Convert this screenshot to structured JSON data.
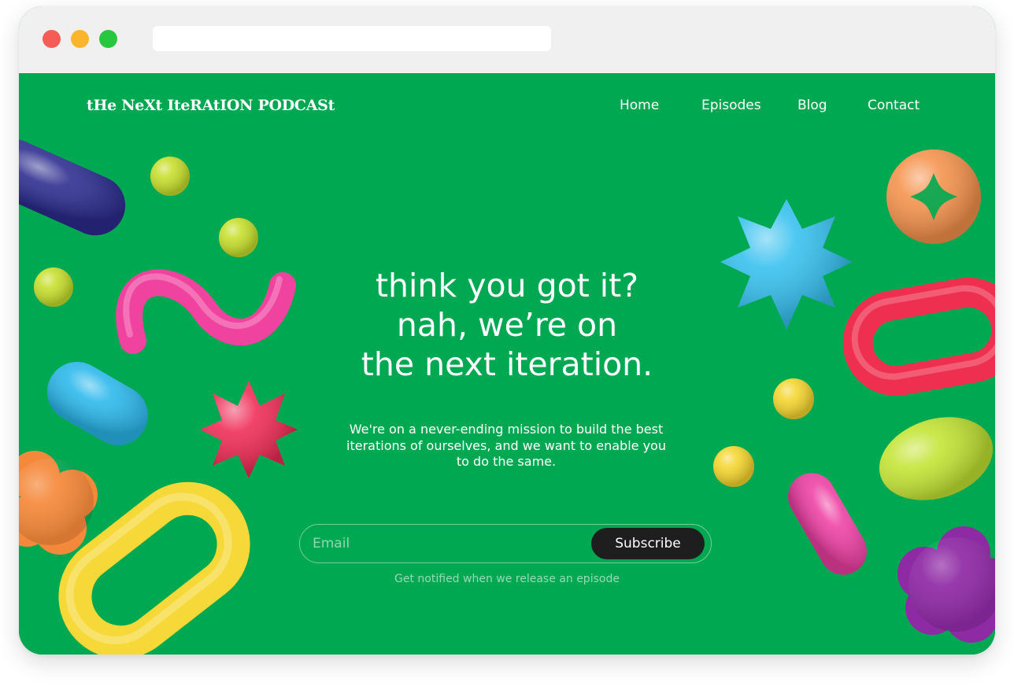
{
  "browser": {
    "traffic_lights": {
      "close": "#f55c55",
      "minimize": "#fbb52c",
      "maximize": "#27c840"
    },
    "address_bar_value": ""
  },
  "site": {
    "background": "#00a851",
    "logo": "tHe NeXt IteRAtION PODCASt",
    "nav": [
      {
        "label": "Home"
      },
      {
        "label": "Episodes"
      },
      {
        "label": "Blog"
      },
      {
        "label": "Contact"
      }
    ]
  },
  "hero": {
    "headline_lines": [
      "think you got it?",
      "nah, we’re on",
      "the next iteration."
    ],
    "subtext": "We're on a never-ending mission to build the best iterations of ourselves, and we want to enable you to do the same."
  },
  "subscribe": {
    "email_placeholder": "Email",
    "email_value": "",
    "button_label": "Subscribe",
    "note": "Get notified when we release an episode"
  },
  "decorations": [
    {
      "name": "navy-capsule-shape",
      "color": "#2b2b8f"
    },
    {
      "name": "lime-ball-shape",
      "color": "#c6df2a"
    },
    {
      "name": "pink-squiggle-shape",
      "color": "#f0439f"
    },
    {
      "name": "cyan-capsule-shape",
      "color": "#2ab8ec"
    },
    {
      "name": "red-star-shape",
      "color": "#ef2a55"
    },
    {
      "name": "orange-flower-shape",
      "color": "#f5893b"
    },
    {
      "name": "yellow-ring-shape",
      "color": "#f6d939"
    },
    {
      "name": "orange-button-shape",
      "color": "#f6924c"
    },
    {
      "name": "blue-star-shape",
      "color": "#35c0ef"
    },
    {
      "name": "red-ring-shape",
      "color": "#ef2f4f"
    },
    {
      "name": "yellow-ball-shape",
      "color": "#f5d52d"
    },
    {
      "name": "lime-bean-shape",
      "color": "#c3e432"
    },
    {
      "name": "pink-capsule-shape",
      "color": "#ee3fa3"
    },
    {
      "name": "purple-flower-shape",
      "color": "#8f2aa5"
    }
  ]
}
